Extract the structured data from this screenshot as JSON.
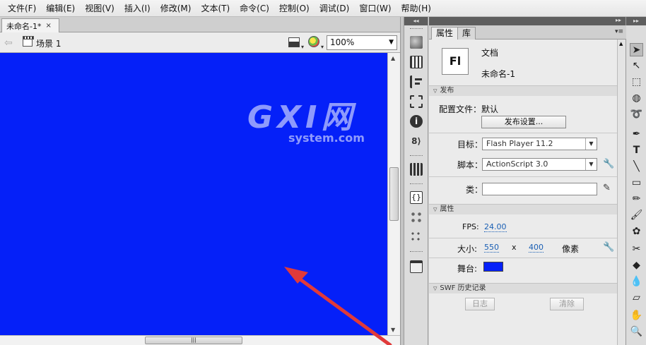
{
  "menu": [
    "文件(F)",
    "编辑(E)",
    "视图(V)",
    "插入(I)",
    "修改(M)",
    "文本(T)",
    "命令(C)",
    "控制(O)",
    "调试(D)",
    "窗口(W)",
    "帮助(H)"
  ],
  "doc_tab": {
    "title": "未命名-1*",
    "close": "×"
  },
  "editbar": {
    "scene": "场景 1",
    "zoom": "100%"
  },
  "stage": {
    "color": "#0520f8"
  },
  "watermark": {
    "big": "GXI网",
    "small": "system.com"
  },
  "properties": {
    "tabs": [
      "属性",
      "库"
    ],
    "doc_icon_text": "Fl",
    "doc_type": "文档",
    "doc_name": "未命名-1",
    "publish": {
      "header": "发布",
      "profile_label": "配置文件：",
      "profile_value": "默认",
      "settings_button": "发布设置...",
      "target_label": "目标：",
      "target_value": "Flash Player 11.2",
      "script_label": "脚本：",
      "script_value": "ActionScript 3.0",
      "class_label": "类："
    },
    "props": {
      "header": "属性",
      "fps_label": "FPS:",
      "fps_value": "24.00",
      "size_label": "大小:",
      "width": "550",
      "x": "x",
      "height": "400",
      "unit": "像素",
      "stage_label": "舞台:",
      "stage_color": "#0520f8"
    },
    "history": {
      "header": "SWF 历史记录",
      "log_button": "日志",
      "clear_button": "清除"
    }
  },
  "colors": {
    "accent": "#1a5fb4",
    "arrow": "#e03a3a"
  }
}
